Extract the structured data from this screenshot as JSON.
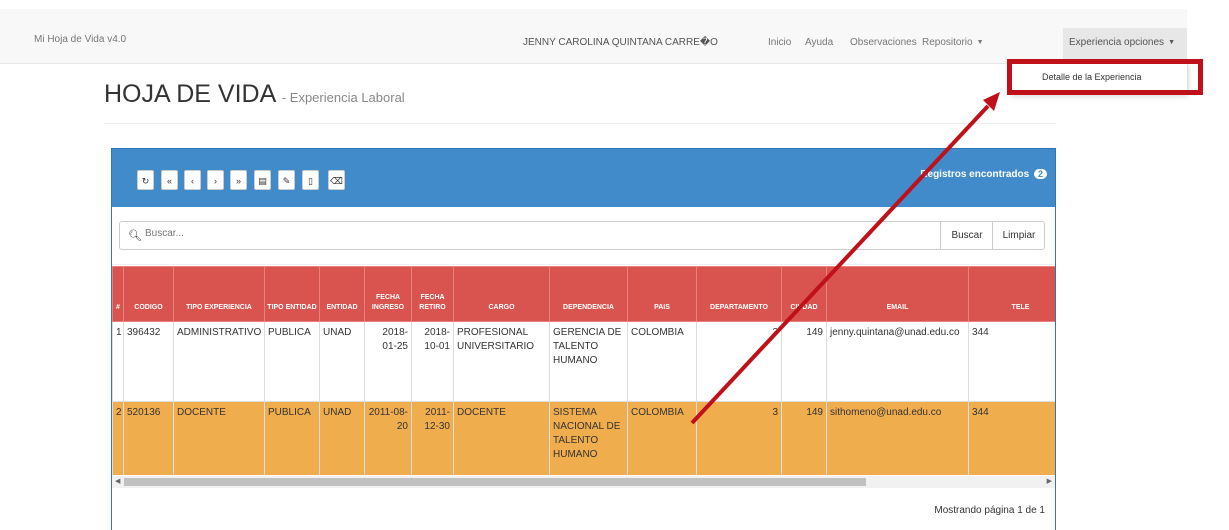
{
  "navbar": {
    "brand": "Mi Hoja de Vida v4.0",
    "user": "JENNY CAROLINA QUINTANA CARRE\u0000O",
    "items": [
      "Inicio",
      "Ayuda",
      "Observaciones"
    ],
    "repositorio": "Repositorio",
    "experiencia": "Experiencia opciones"
  },
  "dropdown": {
    "item": "Detalle de la Experiencia"
  },
  "page": {
    "title": "HOJA DE VIDA",
    "subtitle": "- Experiencia Laboral"
  },
  "toolbar": {
    "buttons": [
      "refresh-icon",
      "first-page-icon",
      "prev-page-icon",
      "next-page-icon",
      "last-page-icon",
      "table-icon",
      "edit-icon",
      "document-icon",
      "eraser-icon"
    ],
    "records_label": "Registros encontrados",
    "records_count": "2"
  },
  "search": {
    "placeholder": "Buscar...",
    "buscar": "Buscar",
    "limpiar": "Limpiar"
  },
  "table": {
    "headers": [
      "#",
      "CODIGO",
      "TIPO EXPERIENCIA",
      "TIPO ENTIDAD",
      "ENTIDAD",
      "FECHA INGRESO",
      "FECHA RETIRO",
      "CARGO",
      "DEPENDENCIA",
      "PAIS",
      "DEPARTAMENTO",
      "CIUDAD",
      "EMAIL",
      "TELE"
    ],
    "rows": [
      [
        "1",
        "396432",
        "ADMINISTRATIVO",
        "PUBLICA",
        "UNAD",
        "2018-01-25",
        "2018-10-01",
        "PROFESIONAL UNIVERSITARIO",
        "GERENCIA DE TALENTO HUMANO",
        "COLOMBIA",
        "3",
        "149",
        "jenny.quintana@unad.edu.co",
        "344"
      ],
      [
        "2",
        "520136",
        "DOCENTE",
        "PUBLICA",
        "UNAD",
        "2011-08-20",
        "2011-12-30",
        "DOCENTE",
        "SISTEMA NACIONAL DE TALENTO HUMANO",
        "COLOMBIA",
        "3",
        "149",
        "sithomeno@unad.edu.co",
        "344"
      ]
    ]
  },
  "footer": {
    "text": "Mostrando página 1 de 1"
  },
  "colors": {
    "panel_header": "#428bca",
    "table_header": "#d9534f",
    "row_highlight": "#f0ad4e",
    "annotation": "#c0101a"
  }
}
